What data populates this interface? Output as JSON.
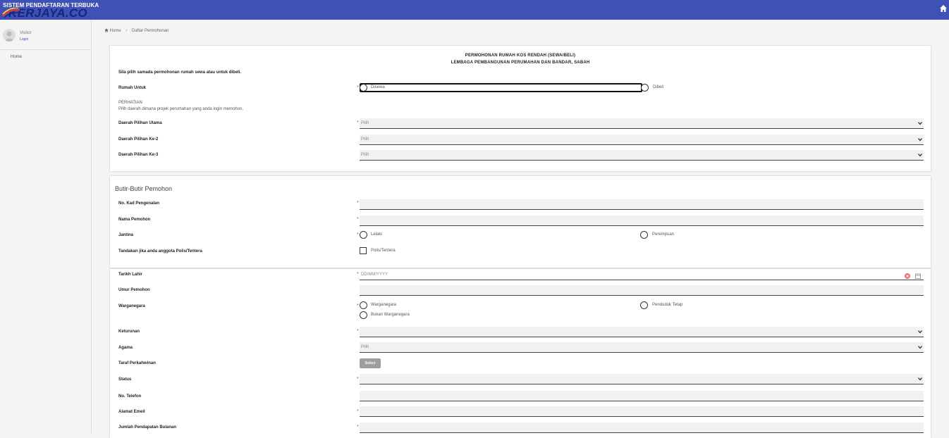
{
  "topbar": {
    "brand_sub": "SISTEM PENDAFTARAN TERBUKA",
    "brand_logo": "KERJAYA.CO",
    "home_icon": "home-icon",
    "color": "#3f51b5"
  },
  "sidebar": {
    "user_name": "Visitor",
    "user_login": "Login",
    "home": "Home"
  },
  "breadcrumb": {
    "home": "Home",
    "sep": "›",
    "current": "Daftar Permohonan"
  },
  "form_header": {
    "title1": "PERMOHONAN RUMAH KOS RENDAH (SEWA/BELI)",
    "title2": "LEMBAGA PEMBANGUNAN PERUMAHAN DAN BANDAR, SABAH",
    "note": "Sila pilih samada permohonan rumah sewa atau untuk dibeli.",
    "rumah_untuk": "Rumah Untuk",
    "opt_disewa": "Disewa",
    "opt_dibeli": "Dibeli",
    "perhatian": "PERHATIAN",
    "perhatian_text": "Pilih daerah dimana projek perumahan yang anda ingin memohon.",
    "daerah1": "Daerah Pilihan Utama",
    "daerah2": "Daerah Pilihan Ke-2",
    "daerah3": "Daerah Pilihan Ke-3",
    "pilih": "Pilih"
  },
  "butir": {
    "title": "Butir-Butir Pemohon",
    "ic": "No. Kad Pengenalan",
    "nama": "Nama Pemohon",
    "jantina": "Jantina",
    "lelaki": "Lelaki",
    "perempuan": "Perempuan",
    "polis_label": "Tandakan jika anda anggota Polis/Tentera",
    "polis_opt": "Polis/Tentera",
    "tarikh": "Tarikh Lahir",
    "tarikh_ph": "DD/MM/YYYY",
    "umur": "Umur Pemohon",
    "warganegara": "Warganegara",
    "opt_warga": "Warganegara",
    "opt_penduduk": "Penduduk Tetap",
    "opt_bukan": "Bukan Warganegara",
    "keturunan": "Keturunan",
    "agama": "Agama",
    "agama_ph": "Pilih",
    "taraf": "Taraf Perkahwinan",
    "select_btn": "Select",
    "status": "Status",
    "telefon": "No. Telefon",
    "emel": "Alamat Emeil",
    "pendapatan": "Jumlah Pendapatan Bulanan",
    "req": "*"
  }
}
